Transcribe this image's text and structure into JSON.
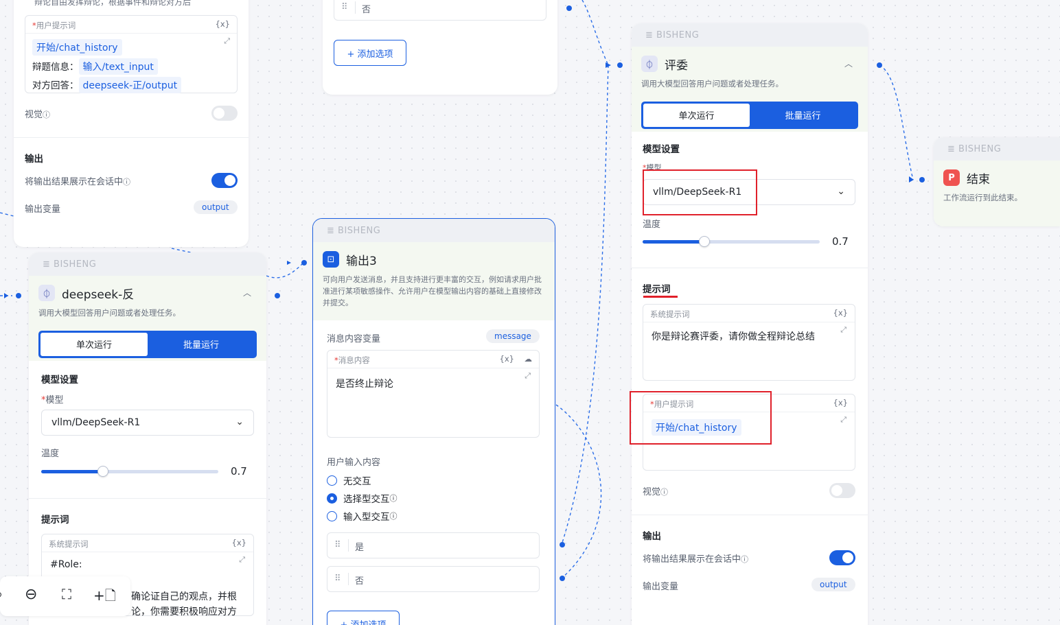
{
  "common": {
    "brand": "BISHENG",
    "single_run": "单次运行",
    "batch_run": "批量运行",
    "model_settings": "模型设置",
    "model_label": "模型",
    "temperature_label": "温度",
    "prompt_title": "提示词",
    "system_prompt_label": "系统提示词",
    "user_prompt_label": "用户提示词",
    "var_icon": "{x}",
    "vision_label": "视觉",
    "output_title": "输出",
    "show_output_label": "将输出结果展示在会话中",
    "output_var_label": "输出变量",
    "output_var_value": "output",
    "add_option": "+ 添加选项",
    "opt_no": "否",
    "opt_yes": "是"
  },
  "node_topleft": {
    "cut_text": "辩论自由发挥辩论，根据事件和辩论对方后",
    "user_prompt_vars": [
      {
        "prefix": "",
        "var": "开始/chat_history"
      },
      {
        "prefix": "辩题信息：",
        "var": "输入/text_input"
      },
      {
        "prefix": "对方回答：",
        "var": "deepseek-正/output"
      }
    ],
    "vision_on": false,
    "show_output_on": true
  },
  "node_deepseek_fan": {
    "title": "deepseek-反",
    "desc": "调用大模型回答用户问题或者处理任务。",
    "model": "vllm/DeepSeek-R1",
    "temperature": 0.7,
    "temperature_display": "0.7",
    "system_prompt_lines": [
      "#Role:",
      "确论证自己的观点，并根",
      "论，你需要积极响应对方"
    ]
  },
  "node_output3": {
    "title": "输出3",
    "desc": "可向用户发送消息，并且支持进行更丰富的交互，例如请求用户批准进行某项敏感操作、允许用户在模型输出内容的基础上直接修改并提交。",
    "msg_var_label": "消息内容变量",
    "msg_var_value": "message",
    "msg_content_label": "消息内容",
    "msg_content": "是否终止辩论",
    "user_input_label": "用户输入内容",
    "radio_options": [
      "无交互",
      "选择型交互",
      "输入型交互"
    ],
    "selected_radio": 1
  },
  "node_judge": {
    "title": "评委",
    "desc": "调用大模型回答用户问题或者处理任务。",
    "model": "vllm/DeepSeek-R1",
    "temperature": 0.7,
    "temperature_display": "0.7",
    "system_prompt": "你是辩论赛评委，请你做全程辩论总结",
    "user_prompt_var": "开始/chat_history",
    "vision_on": false,
    "show_output_on": true
  },
  "node_end": {
    "title": "结束",
    "desc": "工作流运行到此结束。"
  },
  "icons": {
    "zoom_in": "zoom-in-icon",
    "zoom_out": "zoom-out-icon",
    "fit": "fit-view-icon",
    "add_node": "add-node-icon"
  },
  "colors": {
    "accent": "#1b5fe0",
    "highlight": "#e0202a",
    "end_icon": "#ef5350"
  }
}
